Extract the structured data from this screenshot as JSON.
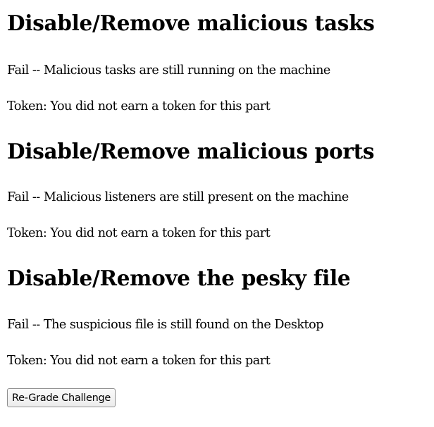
{
  "sections": [
    {
      "title": "Disable/Remove malicious tasks",
      "status": "Fail -- Malicious tasks are still running on the machine",
      "token": "Token: You did not earn a token for this part"
    },
    {
      "title": "Disable/Remove malicious ports",
      "status": "Fail -- Malicious listeners are still present on the machine",
      "token": "Token: You did not earn a token for this part"
    },
    {
      "title": "Disable/Remove the pesky file",
      "status": "Fail -- The suspicious file is still found on the Desktop",
      "token": "Token: You did not earn a token for this part"
    }
  ],
  "regrade_button_label": "Re-Grade Challenge"
}
